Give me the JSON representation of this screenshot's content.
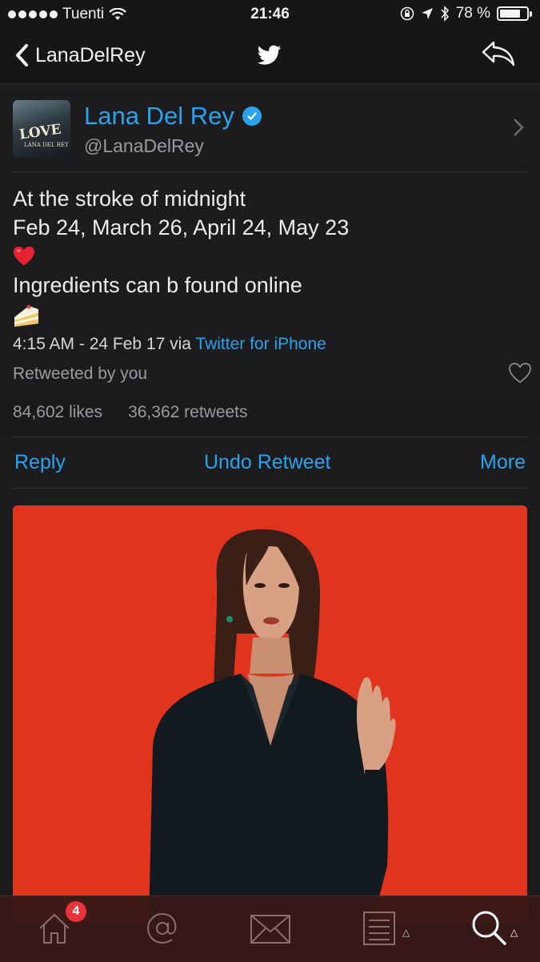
{
  "status_bar": {
    "carrier": "Tuenti",
    "time": "21:46",
    "battery": "78 %",
    "battery_level": 0.78
  },
  "nav": {
    "back_label": "LanaDelRey",
    "logo_icon": "twitter-bird-icon",
    "reply_icon": "reply-arrow-icon"
  },
  "profile": {
    "display_name": "Lana Del Rey",
    "handle": "@LanaDelRey",
    "avatar_text": "LOVE",
    "avatar_subtext": "LANA DEL REY",
    "verified": true
  },
  "tweet": {
    "lines": [
      "At the stroke of midnight",
      "Feb 24, March 26, April 24, May 23",
      "Ingredients can b found online"
    ],
    "emoji_heart": "heart-emoji",
    "emoji_cake": "cake-emoji",
    "timestamp": "4:15 AM - 24 Feb 17 via ",
    "via": "Twitter for iPhone",
    "retweeted_by": "Retweeted by you"
  },
  "stats": {
    "likes": "84,602 likes",
    "retweets": "36,362 retweets"
  },
  "actions": {
    "reply": "Reply",
    "undo_retweet": "Undo Retweet",
    "more": "More"
  },
  "tab_bar": {
    "home_badge": "4",
    "tabs": [
      "home-icon",
      "mentions-icon",
      "messages-icon",
      "lists-icon",
      "search-icon"
    ]
  },
  "colors": {
    "link_blue": "#2aa3ef",
    "background": "#1c1c1e",
    "media_red": "#e1341e",
    "tab_bar": "#381816"
  }
}
